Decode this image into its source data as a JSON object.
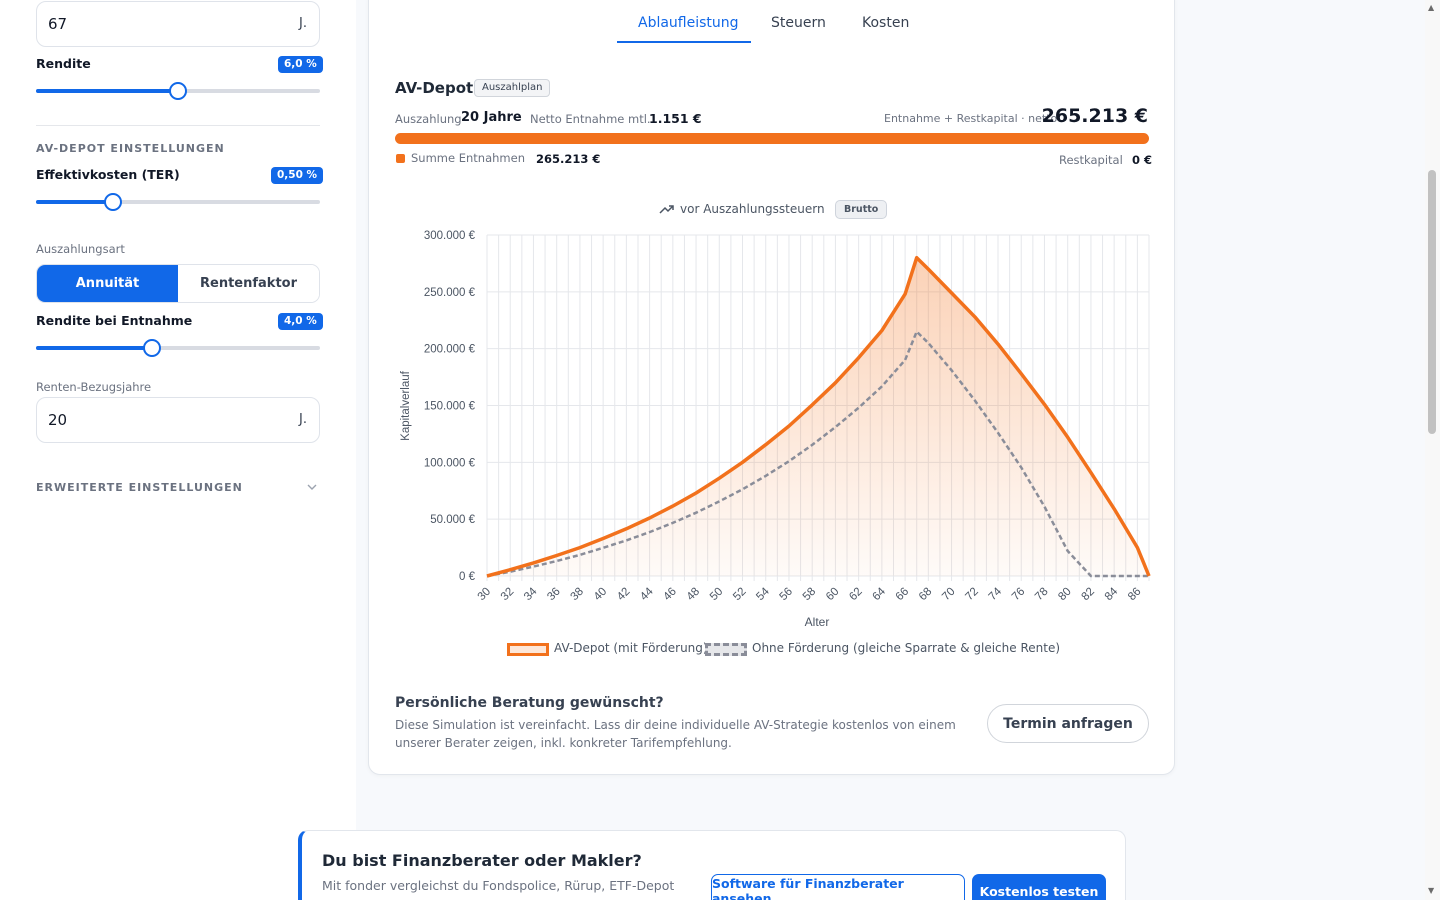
{
  "left_panel": {
    "age_value": "67",
    "age_unit": "J.",
    "rendite_label": "Rendite",
    "rendite_badge": "6,0 %",
    "rendite_level": 0.5,
    "section_av": "AV-DEPOT EINSTELLUNGEN",
    "ter_label": "Effektivkosten (TER)",
    "ter_badge": "0,50 %",
    "ter_level": 0.27,
    "auszahlungsart_label": "Auszahlungsart",
    "seg_annuitaet": "Annuität",
    "seg_rentenfaktor": "Rentenfaktor",
    "rendite_entnahme_label": "Rendite bei Entnahme",
    "rendite_entnahme_badge": "4,0 %",
    "rendite_entnahme_level": 0.41,
    "bezugsjahre_label": "Renten-Bezugsjahre",
    "bezugsjahre_value": "20",
    "bezugsjahre_unit": "J.",
    "erweitert_label": "ERWEITERTE EINSTELLUNGEN"
  },
  "tabs": [
    "Ablaufleistung",
    "Steuern",
    "Kosten"
  ],
  "active_tab": "Ablaufleistung",
  "summary": {
    "title": "AV-Depot",
    "chip": "Auszahlplan",
    "auszahlung_label": "Auszahlung",
    "auszahlung_value": "20 Jahre",
    "netto_label": "Netto Entnahme mtl.",
    "netto_value": "1.151 €",
    "entnahme_label": "Entnahme + Restkapital · netto",
    "entnahme_value": "265.213 €",
    "summe_label": "Summe Entnahmen",
    "summe_value": "265.213 €",
    "rest_label": "Restkapital",
    "rest_value": "0 €"
  },
  "chart_head": {
    "label": "vor Auszahlungssteuern",
    "badge": "Brutto"
  },
  "colors": {
    "accent": "#1168e8",
    "orange": "#f2711c",
    "gray_series": "#8a8d99"
  },
  "chart_data": {
    "type": "area",
    "xlabel": "Alter",
    "ylabel": "Kapitalverlauf",
    "ylim": [
      0,
      300000
    ],
    "y_ticks": [
      0,
      50000,
      100000,
      150000,
      200000,
      250000,
      300000
    ],
    "y_tick_labels": [
      "0 €",
      "50.000 €",
      "100.000 €",
      "150.000 €",
      "200.000 €",
      "250.000 €",
      "300.000 €"
    ],
    "x_tick_labels": [
      "30",
      "32",
      "34",
      "36",
      "38",
      "40",
      "42",
      "44",
      "46",
      "48",
      "50",
      "52",
      "54",
      "56",
      "58",
      "60",
      "62",
      "64",
      "66",
      "68",
      "70",
      "72",
      "74",
      "76",
      "78",
      "80",
      "82",
      "84",
      "86"
    ],
    "x": [
      30,
      32,
      34,
      36,
      38,
      40,
      42,
      44,
      46,
      48,
      50,
      52,
      54,
      56,
      58,
      60,
      62,
      64,
      66,
      67,
      68,
      70,
      72,
      74,
      76,
      78,
      80,
      82,
      84,
      86,
      87
    ],
    "series": [
      {
        "name": "AV-Depot (mit Förderung)",
        "values": [
          0,
          5500,
          11500,
          18000,
          25000,
          33000,
          41500,
          51000,
          61500,
          73000,
          86000,
          100000,
          115500,
          132000,
          150500,
          170000,
          192000,
          216000,
          248000,
          280000,
          270000,
          249000,
          228000,
          204000,
          178000,
          151000,
          122000,
          91000,
          59000,
          25000,
          0
        ]
      },
      {
        "name": "Ohne Förderung (gleiche Sparrate & gleiche Rente)",
        "values": [
          0,
          3800,
          8300,
          13200,
          18600,
          24800,
          31300,
          38600,
          46700,
          55700,
          65600,
          76300,
          88100,
          101000,
          115300,
          131000,
          148000,
          166800,
          190000,
          215000,
          205000,
          181000,
          154500,
          126000,
          95500,
          61000,
          22000,
          0,
          0,
          0,
          0
        ]
      }
    ],
    "legend": "bottom",
    "grid": true
  },
  "cta": {
    "title": "Persönliche Beratung gewünscht?",
    "text": "Diese Simulation ist vereinfacht. Lass dir deine individuelle AV-Strategie kostenlos von einem unserer Berater zeigen, inkl. konkreter Tarifempfehlung.",
    "button": "Termin anfragen"
  },
  "banner": {
    "title": "Du bist Finanzberater oder Makler?",
    "text": "Mit fonder vergleichst du Fondspolice, Rürup, ETF-Depot",
    "btn_outline": "Software für Finanzberater ansehen",
    "btn_solid": "Kostenlos testen"
  }
}
